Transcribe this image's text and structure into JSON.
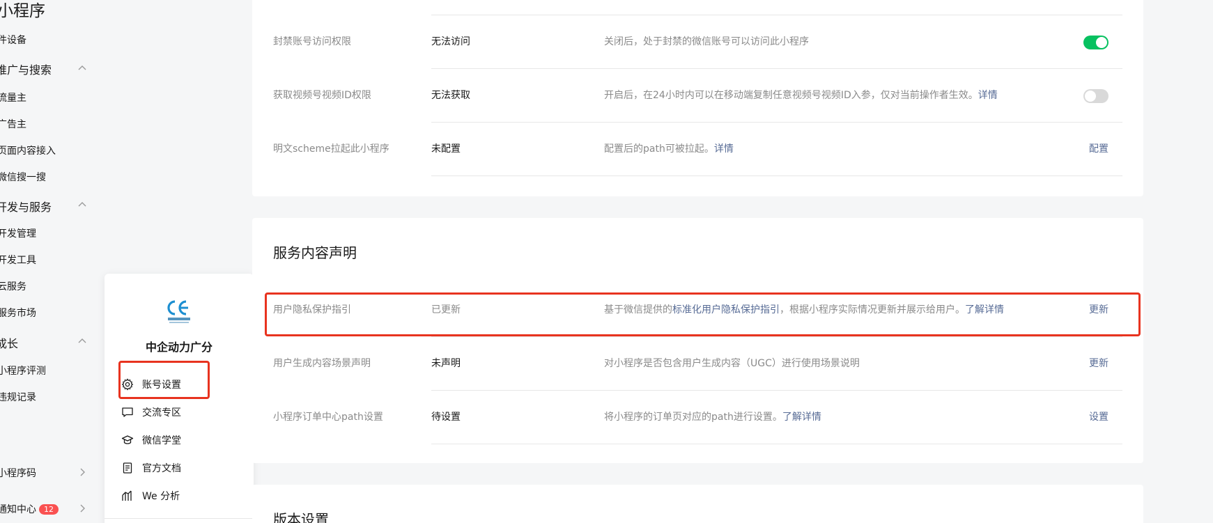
{
  "sidebar": {
    "title": "小程序",
    "items": [
      {
        "label": "件设备",
        "type": "item"
      },
      {
        "label": "推广与搜索",
        "type": "group"
      },
      {
        "label": "流量主",
        "type": "item"
      },
      {
        "label": "广告主",
        "type": "item"
      },
      {
        "label": "页面内容接入",
        "type": "item"
      },
      {
        "label": "微信搜一搜",
        "type": "item"
      },
      {
        "label": "开发与服务",
        "type": "group"
      },
      {
        "label": "开发管理",
        "type": "item"
      },
      {
        "label": "开发工具",
        "type": "item"
      },
      {
        "label": "云服务",
        "type": "item"
      },
      {
        "label": "服务市场",
        "type": "item"
      },
      {
        "label": "成长",
        "type": "group"
      },
      {
        "label": "小程序评测",
        "type": "item"
      },
      {
        "label": "违规记录",
        "type": "item"
      }
    ],
    "qrcode_label": "小程序码",
    "notify_label": "通知中心",
    "notify_count": "12"
  },
  "account_popup": {
    "name": "中企动力广分",
    "menu": [
      {
        "label": "账号设置",
        "icon": "gear-icon"
      },
      {
        "label": "交流专区",
        "icon": "chat-icon"
      },
      {
        "label": "微信学堂",
        "icon": "graduation-cap-icon"
      },
      {
        "label": "官方文档",
        "icon": "document-icon"
      },
      {
        "label": "We 分析",
        "icon": "analytics-icon"
      }
    ]
  },
  "permissions_card": {
    "rows": [
      {
        "label": "封禁账号访问权限",
        "status": "无法访问",
        "desc": "关闭后，处于封禁的微信账号可以访问此小程序",
        "toggle": "on"
      },
      {
        "label": "获取视频号视频ID权限",
        "status": "无法获取",
        "desc": "开启后，在24小时内可以在移动端复制任意视频号视频ID入参，仅对当前操作者生效。",
        "desc_link": "详情",
        "toggle": "off"
      },
      {
        "label": "明文scheme拉起此小程序",
        "status": "未配置",
        "desc": "配置后的path可被拉起。",
        "desc_link": "详情",
        "action": "配置"
      }
    ]
  },
  "service_card": {
    "title": "服务内容声明",
    "rows": [
      {
        "label": "用户隐私保护指引",
        "status": "已更新",
        "desc_pre": "基于微信提供的",
        "desc_link1": "标准化用户隐私保护指引",
        "desc_mid": "，根据小程序实际情况更新并展示给用户。",
        "desc_link2": "了解详情",
        "action": "更新"
      },
      {
        "label": "用户生成内容场景声明",
        "status": "未声明",
        "desc": "对小程序是否包含用户生成内容（UGC）进行使用场景说明",
        "action": "更新"
      },
      {
        "label": "小程序订单中心path设置",
        "status": "待设置",
        "desc": "将小程序的订单页对应的path进行设置。",
        "desc_link": "了解详情",
        "action": "设置"
      }
    ]
  },
  "version_card": {
    "title": "版本设置"
  }
}
